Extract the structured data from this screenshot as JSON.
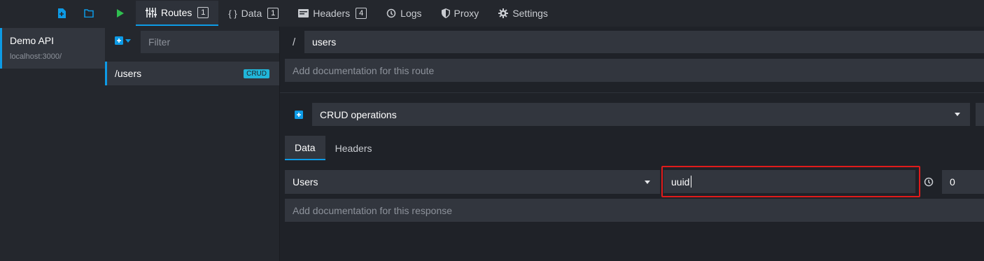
{
  "colors": {
    "accent": "#0d9be6",
    "highlight": "#e01b1b",
    "play": "#2fbf4f",
    "crud_badge": "#21b6d9"
  },
  "environment_toolbar": {
    "icons": [
      "new-file-icon",
      "open-folder-icon"
    ]
  },
  "tabs": [
    {
      "label": "Routes",
      "count": "1",
      "icon": "routes-sliders-icon",
      "active": true
    },
    {
      "label": "Data",
      "count": "1",
      "icon": "braces-icon"
    },
    {
      "label": "Headers",
      "count": "4",
      "icon": "headers-card-icon"
    },
    {
      "label": "Logs",
      "icon": "history-icon"
    },
    {
      "label": "Proxy",
      "icon": "shield-icon"
    },
    {
      "label": "Settings",
      "icon": "gear-icon"
    }
  ],
  "environment": {
    "name": "Demo API",
    "url": "localhost:3000/"
  },
  "routes_panel": {
    "filter_placeholder": "Filter",
    "routes": [
      {
        "path": "/users",
        "badge": "CRUD"
      }
    ]
  },
  "route": {
    "prefix": "/",
    "path": "users",
    "doc_placeholder": "Add documentation for this route"
  },
  "response": {
    "selected": "CRUD operations",
    "subtabs": [
      "Data",
      "Headers"
    ],
    "data_bucket": "Users",
    "key": "uuid",
    "latency": "0",
    "doc_placeholder": "Add documentation for this response"
  }
}
